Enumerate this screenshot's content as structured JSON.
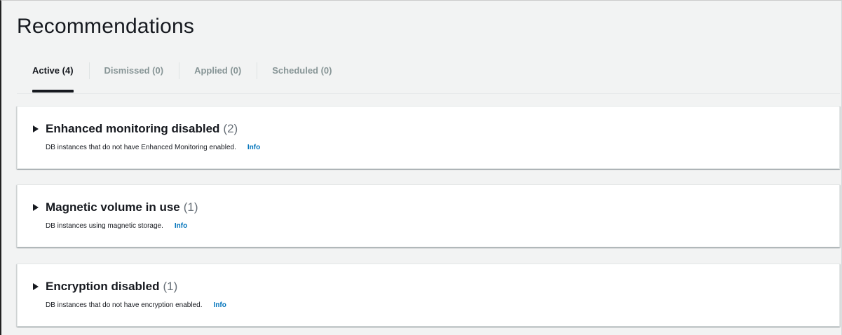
{
  "page": {
    "title": "Recommendations"
  },
  "tabs": [
    {
      "label": "Active (4)"
    },
    {
      "label": "Dismissed (0)"
    },
    {
      "label": "Applied (0)"
    },
    {
      "label": "Scheduled (0)"
    }
  ],
  "cards": [
    {
      "title": "Enhanced monitoring disabled",
      "count": "(2)",
      "description": "DB instances that do not have Enhanced Monitoring enabled.",
      "info_label": "Info"
    },
    {
      "title": "Magnetic volume in use",
      "count": "(1)",
      "description": "DB instances using magnetic storage.",
      "info_label": "Info"
    },
    {
      "title": "Encryption disabled",
      "count": "(1)",
      "description": "DB instances that do not have encryption enabled.",
      "info_label": "Info"
    }
  ],
  "colors": {
    "background": "#f2f3f3",
    "text": "#16191f",
    "muted": "#879596",
    "link": "#0073bb"
  }
}
